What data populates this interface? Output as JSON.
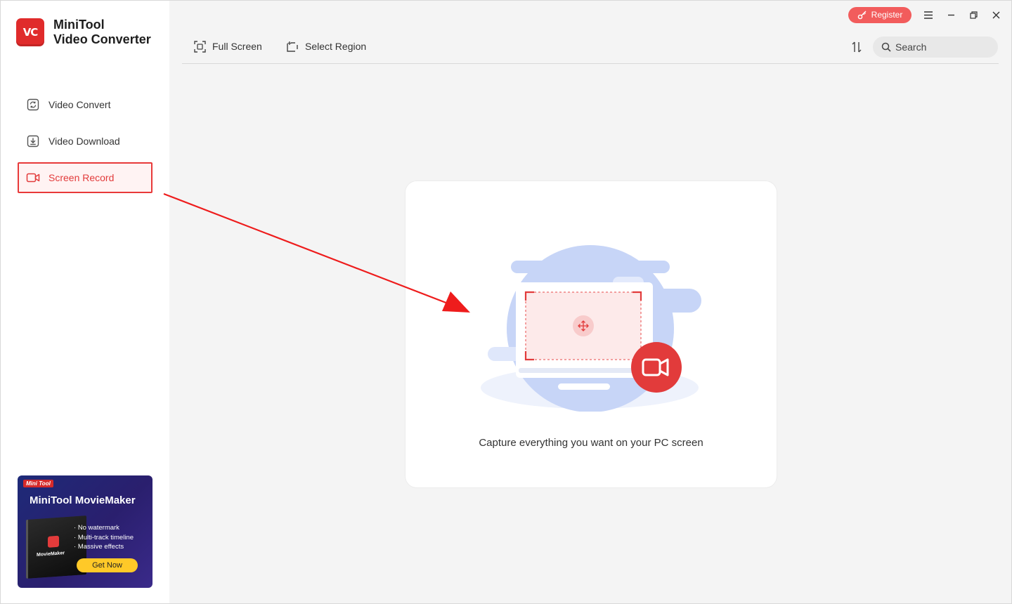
{
  "app": {
    "name_line1": "MiniTool",
    "name_line2": "Video Converter",
    "logo_letters": "VC"
  },
  "sidebar": {
    "items": [
      {
        "label": "Video Convert",
        "icon": "convert-icon",
        "active": false
      },
      {
        "label": "Video Download",
        "icon": "download-icon",
        "active": false
      },
      {
        "label": "Screen Record",
        "icon": "camera-icon",
        "active": true
      }
    ]
  },
  "promo": {
    "brand": "Mini Tool",
    "title": "MiniTool MovieMaker",
    "box_label": "MovieMaker",
    "features": [
      "No watermark",
      "Multi-track timeline",
      "Massive effects"
    ],
    "cta": "Get Now"
  },
  "toolbar": {
    "full_screen": "Full Screen",
    "select_region": "Select Region",
    "search_placeholder": "Search"
  },
  "window": {
    "register": "Register"
  },
  "main": {
    "caption": "Capture everything you want on your PC screen"
  },
  "colors": {
    "accent": "#e83a3a",
    "register_bg": "#f25c5c",
    "illustration_blue": "#c7d5f7"
  }
}
